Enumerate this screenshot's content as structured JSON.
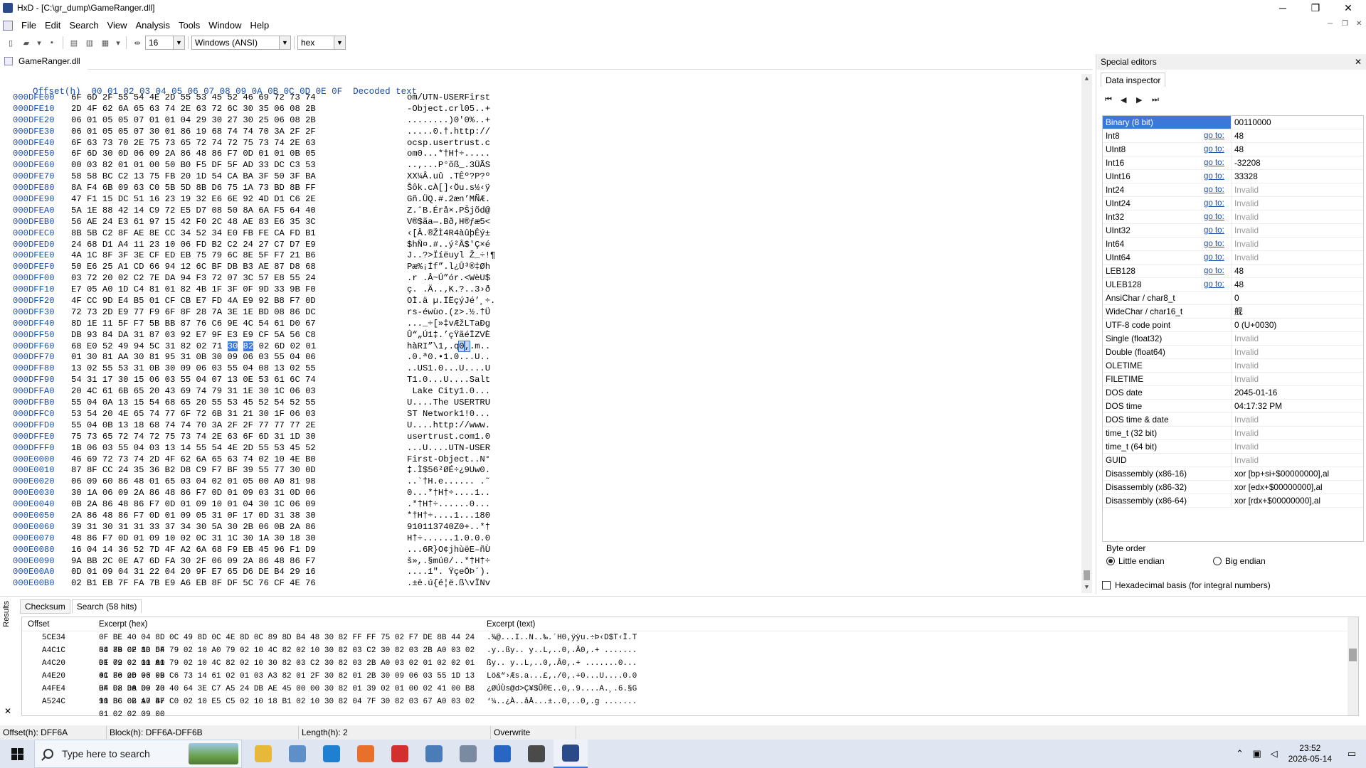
{
  "window": {
    "title": "HxD - [C:\\gr_dump\\GameRanger.dll]",
    "controls": {
      "minimize": "─",
      "maximize": "❐",
      "close": "✕"
    }
  },
  "menu": [
    "File",
    "Edit",
    "Search",
    "View",
    "Analysis",
    "Tools",
    "Window",
    "Help"
  ],
  "toolbar": {
    "bytes_per_row": "16",
    "charset": "Windows (ANSI)",
    "offset_base": "hex"
  },
  "tab": {
    "label": "GameRanger.dll"
  },
  "hex": {
    "header_offset": "Offset(h)",
    "header_cols": "00 01 02 03 04 05 06 07 08 09 0A 0B 0C 0D 0E 0F",
    "header_text": "Decoded text",
    "rows": [
      {
        "off": "000DFE00",
        "hex": "6F 6D 2F 55 54 4E 2D 55 53 45 52 46 69 72 73 74",
        "txt": "om/UTN-USERFirst"
      },
      {
        "off": "000DFE10",
        "hex": "2D 4F 62 6A 65 63 74 2E 63 72 6C 30 35 06 08 2B",
        "txt": "-Object.crl05..+"
      },
      {
        "off": "000DFE20",
        "hex": "06 01 05 05 07 01 01 04 29 30 27 30 25 06 08 2B",
        "txt": "........)0'0%..+"
      },
      {
        "off": "000DFE30",
        "hex": "06 01 05 05 07 30 01 86 19 68 74 74 70 3A 2F 2F",
        "txt": ".....0.†.http://"
      },
      {
        "off": "000DFE40",
        "hex": "6F 63 73 70 2E 75 73 65 72 74 72 75 73 74 2E 63",
        "txt": "ocsp.usertrust.c"
      },
      {
        "off": "000DFE50",
        "hex": "6F 6D 30 0D 06 09 2A 86 48 86 F7 0D 01 01 0B 05",
        "txt": "om0...*†H†÷....."
      },
      {
        "off": "000DFE60",
        "hex": "00 03 82 01 01 00 50 B0 F5 DF 5F AD 33 DC C3 53",
        "txt": "..‚...P°õß_.3ÜÃS"
      },
      {
        "off": "000DFE70",
        "hex": "58 58 BC C2 13 75 FB 20 1D 54 CA BA 3F 50 3F BA",
        "txt": "XX¼Â.uû .TÊº?P?º"
      },
      {
        "off": "000DFE80",
        "hex": "8A F4 6B 09 63 C0 5B 5D 8B D6 75 1A 73 BD 8B FF",
        "txt": "Šôk.cÀ[]‹Öu.s½‹ÿ"
      },
      {
        "off": "000DFE90",
        "hex": "47 F1 15 DC 51 16 23 19 32 E6 6E 92 4D D1 C6 2E",
        "txt": "Gñ.ÜQ.#.2æn’MÑÆ."
      },
      {
        "off": "000DFEA0",
        "hex": "5A 1E 88 42 14 C9 72 E5 D7 08 50 8A 6A F5 64 40",
        "txt": "Z.ˆB.Érå×.PŠjõd@"
      },
      {
        "off": "000DFEB0",
        "hex": "56 AE 24 E3 61 97 15 42 F0 2C 48 AE 83 E6 35 3C",
        "txt": "V®$ãa—.Bð,H®ƒæ5<"
      },
      {
        "off": "000DFEC0",
        "hex": "8B 5B C2 8F AE 8E CC 34 52 34 E0 FB FE CA FD B1",
        "txt": "‹[Â.®ŽÌ4R4àûþÊý±"
      },
      {
        "off": "000DFED0",
        "hex": "24 68 D1 A4 11 23 10 06 FD B2 C2 24 27 C7 D7 E9",
        "txt": "$hÑ¤.#..ý²Â$'Ç×é"
      },
      {
        "off": "000DFEE0",
        "hex": "4A 1C 8F 3F 3E CF ED EB 75 79 6C 8E 5F F7 21 B6",
        "txt": "J..?>Ïíëuyl Ž_÷!¶"
      },
      {
        "off": "000DFEF0",
        "hex": "50 E6 25 A1 CD 66 94 12 6C BF DB B3 AE 87 D8 68",
        "txt": "Pæ%¡Íf”.l¿Û³®‡Øh"
      },
      {
        "off": "000DFF00",
        "hex": "03 72 20 02 C2 7E DA 94 F3 72 07 3C 57 E8 55 24",
        "txt": ".r .Â~Ú”ór.<WèU$"
      },
      {
        "off": "000DFF10",
        "hex": "E7 05 A0 1D C4 81 01 82 4B 1F 3F 0F 9D 33 9B F0",
        "txt": "ç. .Ä..‚K.?..3›ð"
      },
      {
        "off": "000DFF20",
        "hex": "4F CC 9D E4 B5 01 CF CB E7 FD 4A E9 92 B8 F7 0D",
        "txt": "OÌ.ä µ.ÏËçýJé’¸÷."
      },
      {
        "off": "000DFF30",
        "hex": "72 73 2D E9 77 F9 6F 8F 28 7A 3E 1E BD 08 86 DC",
        "txt": "rs-éwùo.(z>.½.†Ü"
      },
      {
        "off": "000DFF40",
        "hex": "8D 1E 11 5F F7 5B BB 87 76 C6 9E 4C 54 61 D0 67",
        "txt": "..._÷[»‡vÆžLTaÐg"
      },
      {
        "off": "000DFF50",
        "hex": "DB 93 84 DA 31 87 03 92 E7 9F E3 E9 CF 5A 56 C8",
        "txt": "Û“„Ú1‡.’çŸãéÏZVÈ"
      },
      {
        "off": "000DFF60",
        "hex": "68 E0 52 49 94 5C 31 82 02 71 30 82 02 6D 02 01",
        "txt": "hàRI”\\1‚.q0‚.m..",
        "sel": true
      },
      {
        "off": "000DFF70",
        "hex": "01 30 81 AA 30 81 95 31 0B 30 09 06 03 55 04 06",
        "txt": ".0.ª0.•1.0...U.."
      },
      {
        "off": "000DFF80",
        "hex": "13 02 55 53 31 0B 30 09 06 03 55 04 08 13 02 55",
        "txt": "..US1.0...U....U"
      },
      {
        "off": "000DFF90",
        "hex": "54 31 17 30 15 06 03 55 04 07 13 0E 53 61 6C 74",
        "txt": "T1.0...U....Salt"
      },
      {
        "off": "000DFFA0",
        "hex": "20 4C 61 6B 65 20 43 69 74 79 31 1E 30 1C 06 03",
        "txt": " Lake City1.0..."
      },
      {
        "off": "000DFFB0",
        "hex": "55 04 0A 13 15 54 68 65 20 55 53 45 52 54 52 55",
        "txt": "U....The USERTRU"
      },
      {
        "off": "000DFFC0",
        "hex": "53 54 20 4E 65 74 77 6F 72 6B 31 21 30 1F 06 03",
        "txt": "ST Network1!0..."
      },
      {
        "off": "000DFFD0",
        "hex": "55 04 0B 13 18 68 74 74 70 3A 2F 2F 77 77 77 2E",
        "txt": "U....http://www."
      },
      {
        "off": "000DFFE0",
        "hex": "75 73 65 72 74 72 75 73 74 2E 63 6F 6D 31 1D 30",
        "txt": "usertrust.com1.0"
      },
      {
        "off": "000DFFF0",
        "hex": "1B 06 03 55 04 03 13 14 55 54 4E 2D 55 53 45 52",
        "txt": "...U....UTN-USER"
      },
      {
        "off": "000E0000",
        "hex": "46 69 72 73 74 2D 4F 62 6A 65 63 74 02 10 4E B0",
        "txt": "First-Object..N°"
      },
      {
        "off": "000E0010",
        "hex": "87 8F CC 24 35 36 B2 D8 C9 F7 BF 39 55 77 30 0D",
        "txt": "‡.Ì$56²ØÉ÷¿9Uw0."
      },
      {
        "off": "000E0020",
        "hex": "06 09 60 86 48 01 65 03 04 02 01 05 00 A0 81 98",
        "txt": "..`†H.e...... .˜"
      },
      {
        "off": "000E0030",
        "hex": "30 1A 06 09 2A 86 48 86 F7 0D 01 09 03 31 0D 06",
        "txt": "0...*†H†÷....1.."
      },
      {
        "off": "000E0040",
        "hex": "0B 2A 86 48 86 F7 0D 01 09 10 01 04 30 1C 06 09",
        "txt": ".*†H†÷......0..."
      },
      {
        "off": "000E0050",
        "hex": "2A 86 48 86 F7 0D 01 09 05 31 0F 17 0D 31 38 30",
        "txt": "*†H†÷....1...180"
      },
      {
        "off": "000E0060",
        "hex": "39 31 30 31 31 33 37 34 30 5A 30 2B 06 0B 2A 86",
        "txt": "910113740Z0+..*†"
      },
      {
        "off": "000E0070",
        "hex": "48 86 F7 0D 01 09 10 02 0C 31 1C 30 1A 30 18 30",
        "txt": "H†÷......1.0.0.0"
      },
      {
        "off": "000E0080",
        "hex": "16 04 14 36 52 7D 4F A2 6A 68 F9 EB 45 96 F1 D9",
        "txt": "...6R}O¢jhùëE–ñÙ"
      },
      {
        "off": "000E0090",
        "hex": "9A BB 2C 0E A7 6D FA 30 2F 06 09 2A 86 48 86 F7",
        "txt": "š»,.§mú0/..*†H†÷"
      },
      {
        "off": "000E00A0",
        "hex": "0D 01 09 04 31 22 04 20 9F E7 65 D6 DE B4 29 16",
        "txt": "....1\". ŸçeÖÞ´)."
      },
      {
        "off": "000E00B0",
        "hex": "02 B1 EB 7F FA 7B E9 A6 EB 8F DF 5C 76 CF 4E 76",
        "txt": ".±ë.ú{é¦ë.ß\\vÏNv"
      }
    ]
  },
  "special": {
    "header": "Special editors",
    "tab": "Data inspector",
    "goto_label": "go to:",
    "rows": [
      {
        "k": "Binary (8 bit)",
        "v": "00110000",
        "hi": true
      },
      {
        "k": "Int8",
        "goto": true,
        "v": "48"
      },
      {
        "k": "UInt8",
        "goto": true,
        "v": "48"
      },
      {
        "k": "Int16",
        "goto": true,
        "v": "-32208"
      },
      {
        "k": "UInt16",
        "goto": true,
        "v": "33328"
      },
      {
        "k": "Int24",
        "goto": true,
        "v": "Invalid",
        "inv": true
      },
      {
        "k": "UInt24",
        "goto": true,
        "v": "Invalid",
        "inv": true
      },
      {
        "k": "Int32",
        "goto": true,
        "v": "Invalid",
        "inv": true
      },
      {
        "k": "UInt32",
        "goto": true,
        "v": "Invalid",
        "inv": true
      },
      {
        "k": "Int64",
        "goto": true,
        "v": "Invalid",
        "inv": true
      },
      {
        "k": "UInt64",
        "goto": true,
        "v": "Invalid",
        "inv": true
      },
      {
        "k": "LEB128",
        "goto": true,
        "v": "48"
      },
      {
        "k": "ULEB128",
        "goto": true,
        "v": "48"
      },
      {
        "k": "AnsiChar / char8_t",
        "v": "0"
      },
      {
        "k": "WideChar / char16_t",
        "v": "舰"
      },
      {
        "k": "UTF-8 code point",
        "v": "0 (U+0030)"
      },
      {
        "k": "Single (float32)",
        "v": "Invalid",
        "inv": true
      },
      {
        "k": "Double (float64)",
        "v": "Invalid",
        "inv": true
      },
      {
        "k": "OLETIME",
        "v": "Invalid",
        "inv": true
      },
      {
        "k": "FILETIME",
        "v": "Invalid",
        "inv": true
      },
      {
        "k": "DOS date",
        "v": "2045-01-16"
      },
      {
        "k": "DOS time",
        "v": "04:17:32 PM"
      },
      {
        "k": "DOS time & date",
        "v": "Invalid",
        "inv": true
      },
      {
        "k": "time_t (32 bit)",
        "v": "Invalid",
        "inv": true
      },
      {
        "k": "time_t (64 bit)",
        "v": "Invalid",
        "inv": true
      },
      {
        "k": "GUID",
        "v": "Invalid",
        "inv": true
      },
      {
        "k": "Disassembly (x86-16)",
        "v": "xor [bp+si+$00000000],al"
      },
      {
        "k": "Disassembly (x86-32)",
        "v": "xor [edx+$00000000],al"
      },
      {
        "k": "Disassembly (x86-64)",
        "v": "xor [rdx+$00000000],al"
      }
    ],
    "byte_order_label": "Byte order",
    "little_endian": "Little endian",
    "big_endian": "Big endian",
    "hex_basis": "Hexadecimal basis (for integral numbers)"
  },
  "results": {
    "side_label": "Results",
    "tabs": [
      "Checksum",
      "Search (58 hits)"
    ],
    "cols": [
      "Offset",
      "Excerpt (hex)",
      "Excerpt (text)"
    ],
    "rows": [
      {
        "off": "5CE34",
        "hex": "0F BE 40 04 8D 0C 49 8D 0C 4E 8D 0C 89 8D B4 48 30 82 FF FF 75 02 F7 DE 8B 44 24 54 8B CF 8D 54",
        "txt": ".¾@...I..N..‰.´H0‚ÿÿu.÷Þ‹D$T‹Ï.T"
      },
      {
        "off": "A4C1C",
        "hex": "08 79 02 10 DF 79 02 10 A0 79 02 10 4C 82 02 10 30 82 03 C2 30 82 03 2B A0 03 02 01 02 02 01 01",
        "txt": ".y..ßy.. y..L‚..0‚.Â0‚.+ ......."
      },
      {
        "off": "A4C20",
        "hex": "DF 79 02 10 A0 79 02 10 4C 82 02 10 30 82 03 C2 30 82 03 2B A0 03 02 01 02 02 01 01 30 0D 06 09",
        "txt": "ßy.. y..L‚..0‚.Â0‚.+ .......0..."
      },
      {
        "off": "A4E20",
        "hex": "4C F6 26 93 9B C6 73 14 61 02 01 03 A3 82 01 2F 30 82 01 2B 30 09 06 03 55 1D 13 04 02 30 00 30",
        "txt": "Lö&“›Æs.a...£‚./0‚.+0...U....0.0"
      },
      {
        "off": "A4FE4",
        "hex": "BF D8 DA D9 73 40 64 3E C7 A5 24 DB AE 45 00 00 30 82 01 39 02 01 00 02 41 00 B8 10 36 0B A7 47",
        "txt": "¿ØÚÙs@d>Ç¥$Û®E..0‚.9....A.¸.6.§G"
      },
      {
        "off": "A524C",
        "hex": "91 BC 02 10 BF C0 02 10 E5 C5 02 10 18 B1 02 10 30 82 04 7F 30 82 03 67 A0 03 02 01 02 02 09 00",
        "txt": "‘¼..¿À..åÅ...±..0‚..0‚.g ......."
      }
    ]
  },
  "status": {
    "offset": "Offset(h): DFF6A",
    "block": "Block(h): DFF6A-DFF6B",
    "length": "Length(h): 2",
    "mode": "Overwrite"
  },
  "taskbar": {
    "search_placeholder": "Type here to search",
    "time": "23:52",
    "date": "2026-05-14",
    "apps": [
      "file-explorer-icon",
      "notepad-icon",
      "edge-icon",
      "firefox-icon",
      "opera-icon",
      "network-icon",
      "archive-icon",
      "layers-icon",
      "window-icon",
      "hxd-icon"
    ]
  }
}
